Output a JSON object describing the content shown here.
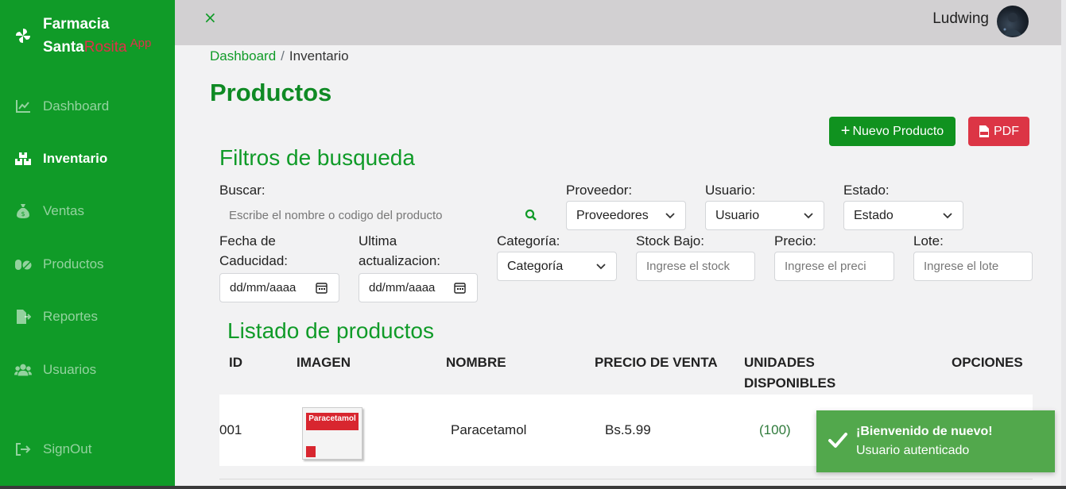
{
  "brand": {
    "line1": "Farmacia",
    "santa": "Santa",
    "rosita": "Rosita",
    "app": "App"
  },
  "sidebar": {
    "items": [
      {
        "label": "Dashboard",
        "icon": "line-chart-icon"
      },
      {
        "label": "Inventario",
        "icon": "boxes-icon",
        "active": true
      },
      {
        "label": "Ventas",
        "icon": "money-bag-icon"
      },
      {
        "label": "Productos",
        "icon": "pills-icon"
      },
      {
        "label": "Reportes",
        "icon": "file-export-icon"
      },
      {
        "label": "Usuarios",
        "icon": "users-icon"
      }
    ],
    "signout": "SignOut"
  },
  "topbar": {
    "close": "×",
    "user_name": "Ludwing"
  },
  "breadcrumb": {
    "link": "Dashboard",
    "separator": "/",
    "current": "Inventario"
  },
  "page": {
    "title": "Productos"
  },
  "buttons": {
    "new_product": "Nuevo Producto",
    "new_plus": "+",
    "pdf": "PDF"
  },
  "filters": {
    "title": "Filtros de busqueda",
    "search_label": "Buscar:",
    "search_placeholder": "Escribe el nombre o codigo del producto",
    "provider_label": "Proveedor:",
    "provider_value": "Proveedores",
    "user_label": "Usuario:",
    "user_value": "Usuario",
    "state_label": "Estado:",
    "state_value": "Estado",
    "expiry_label_1": "Fecha de",
    "expiry_label_2": "Caducidad:",
    "expiry_value": "dd/mm/aaaa",
    "updated_label_1": "Ultima",
    "updated_label_2": "actualizacion:",
    "updated_value": "dd/mm/aaaa",
    "category_label": "Categoría:",
    "category_value": "Categoría",
    "stock_label": "Stock Bajo:",
    "stock_placeholder": "Ingrese el stock",
    "price_label": "Precio:",
    "price_placeholder": "Ingrese el preci",
    "lot_label": "Lote:",
    "lot_placeholder": "Ingrese el lote"
  },
  "list": {
    "title": "Listado de productos",
    "headers": {
      "id": "ID",
      "image": "IMAGEN",
      "name": "NOMBRE",
      "price": "PRECIO DE VENTA",
      "units_1": "UNIDADES",
      "units_2": "DISPONIBLES",
      "options": "OPCIONES"
    },
    "rows": [
      {
        "id": "001",
        "image_text": "Paracetamol",
        "name": "Paracetamol",
        "price": "Bs.5.99",
        "units": "(100)"
      }
    ]
  },
  "toast": {
    "title": "¡Bienvenido de nuevo!",
    "message": "Usuario autenticado"
  },
  "colors": {
    "sidebar": "#109b28",
    "primary": "#109b28",
    "danger": "#dc3545",
    "toast": "#52a84c",
    "rosita": "#e0304a"
  }
}
